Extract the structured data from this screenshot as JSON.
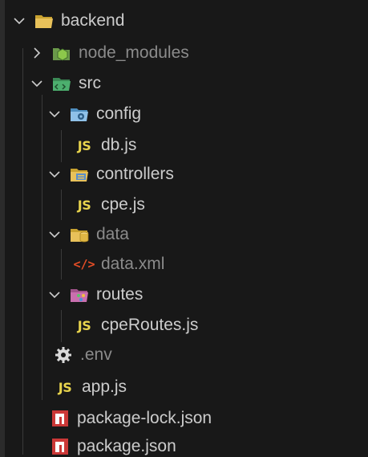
{
  "tree": {
    "backend": {
      "label": "backend",
      "expanded": true,
      "icon": "folder-open-icon"
    },
    "node_modules": {
      "label": "node_modules",
      "expanded": false,
      "icon": "node-folder-icon",
      "dimmed": true
    },
    "src": {
      "label": "src",
      "expanded": true,
      "icon": "src-folder-icon"
    },
    "config": {
      "label": "config",
      "expanded": true,
      "icon": "config-folder-icon"
    },
    "db_js": {
      "label": "db.js",
      "icon_text": "JS"
    },
    "controllers": {
      "label": "controllers",
      "expanded": true,
      "icon": "controllers-folder-icon"
    },
    "cpe_js": {
      "label": "cpe.js",
      "icon_text": "JS"
    },
    "data": {
      "label": "data",
      "expanded": true,
      "icon": "data-folder-icon",
      "dimmed": true
    },
    "data_xml": {
      "label": "data.xml",
      "icon_text": "</>",
      "dimmed": true
    },
    "routes": {
      "label": "routes",
      "expanded": true,
      "icon": "routes-folder-icon"
    },
    "cpeRoutes_js": {
      "label": "cpeRoutes.js",
      "icon_text": "JS"
    },
    "env": {
      "label": ".env",
      "icon": "gear-icon",
      "dimmed": true
    },
    "app_js": {
      "label": "app.js",
      "icon_text": "JS"
    },
    "package_lock_json": {
      "label": "package-lock.json",
      "icon": "npm-icon"
    },
    "package_json": {
      "label": "package.json",
      "icon": "npm-icon"
    }
  },
  "colors": {
    "background": "#181818",
    "text": "#cccccc",
    "dim_text": "#8b8b8b",
    "js_badge": "#e8d44d",
    "xml_badge": "#e44d26",
    "npm_red": "#cb3837"
  }
}
